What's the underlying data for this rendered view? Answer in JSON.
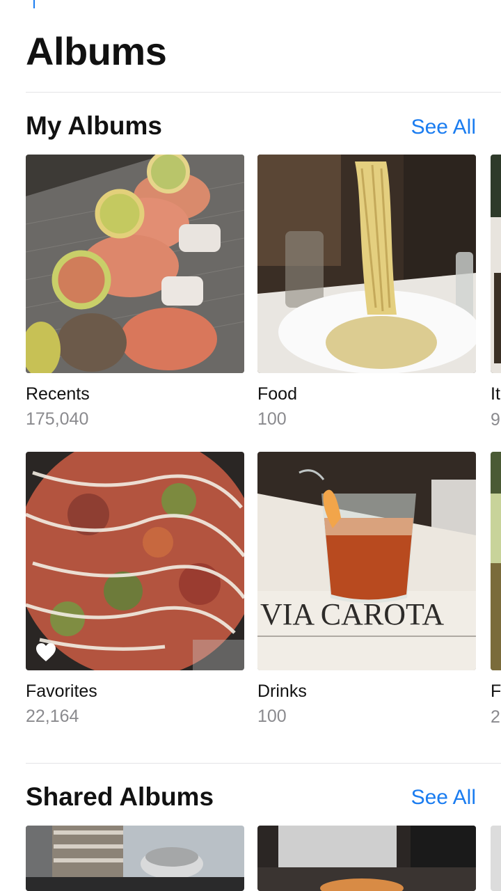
{
  "page": {
    "title": "Albums"
  },
  "my_albums": {
    "title": "My Albums",
    "see_all": "See All",
    "albums": [
      {
        "name": "Recents",
        "count": "175,040"
      },
      {
        "name": "Food",
        "count": "100"
      },
      {
        "name": "Favorites",
        "count": "22,164"
      },
      {
        "name": "Drinks",
        "count": "100"
      }
    ],
    "peek": [
      {
        "name": "It",
        "count": "9"
      },
      {
        "name": "F",
        "count": "2"
      }
    ]
  },
  "shared_albums": {
    "title": "Shared Albums",
    "see_all": "See All"
  },
  "thumbnails": {
    "drinks_menu_text": "VIA CAROTA"
  },
  "icons": {
    "favorite": "heart-icon"
  },
  "colors": {
    "accent": "#1a7cf0",
    "secondary_text": "#8a8a8e",
    "divider": "#e4e4e6"
  }
}
